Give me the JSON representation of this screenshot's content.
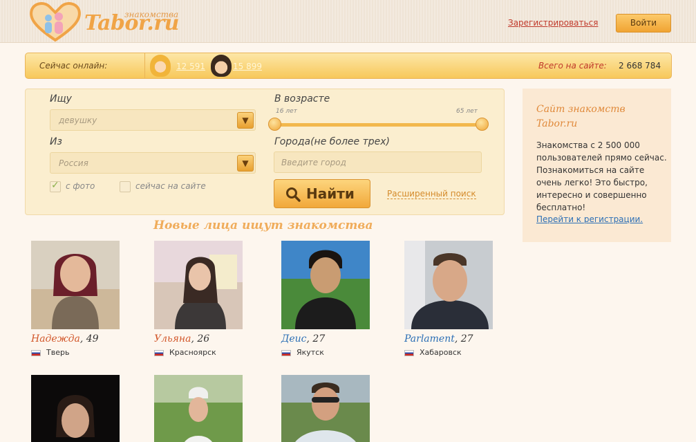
{
  "header": {
    "logo_small": "знакомства",
    "logo_main": "Tabor.ru",
    "register_link": "Зарегистрироваться",
    "login_button": "Войти"
  },
  "online_bar": {
    "label": "Сейчас онлайн:",
    "women_count": "12 591",
    "men_count": "15 899",
    "total_label": "Всего на сайте:",
    "total_value": "2 668 784"
  },
  "search": {
    "looking_for_label": "Ищу",
    "looking_for_value": "девушку",
    "from_label": "Из",
    "from_value": "Россия",
    "age_label": "В возрасте",
    "age_min": "16 лет",
    "age_max": "65 лет",
    "age_range": [
      16,
      65
    ],
    "cities_label": "Города(не более трех)",
    "city_placeholder": "Введите город",
    "with_photo_label": "с фото",
    "with_photo_checked": true,
    "online_now_label": "сейчас на сайте",
    "online_now_checked": false,
    "find_button": "Найти",
    "advanced_link": "Расширенный поиск"
  },
  "info": {
    "title": "Сайт знакомств Tabor.ru",
    "text": "Знакомства с 2 500 000 пользователей прямо сейчас. Познакомиться на сайте очень легко! Это быстро, интересно и совершенно бесплатно!",
    "link": "Перейти к регистрации."
  },
  "new_faces": {
    "title": "Новые лица ищут знакомства",
    "people": [
      {
        "name": "Надежда",
        "age": ", 49",
        "city": "Тверь",
        "gender": "f"
      },
      {
        "name": "Ульяна",
        "age": ", 26",
        "city": "Красноярск",
        "gender": "f"
      },
      {
        "name": "Деис",
        "age": ", 27",
        "city": "Якутск",
        "gender": "m"
      },
      {
        "name": "Parlament",
        "age": ", 27",
        "city": "Хабаровск",
        "gender": "m"
      }
    ]
  },
  "colors": {
    "accent": "#f0a447",
    "female_name": "#d2572a",
    "male_name": "#2c6fb5",
    "link_red": "#c0392b"
  }
}
